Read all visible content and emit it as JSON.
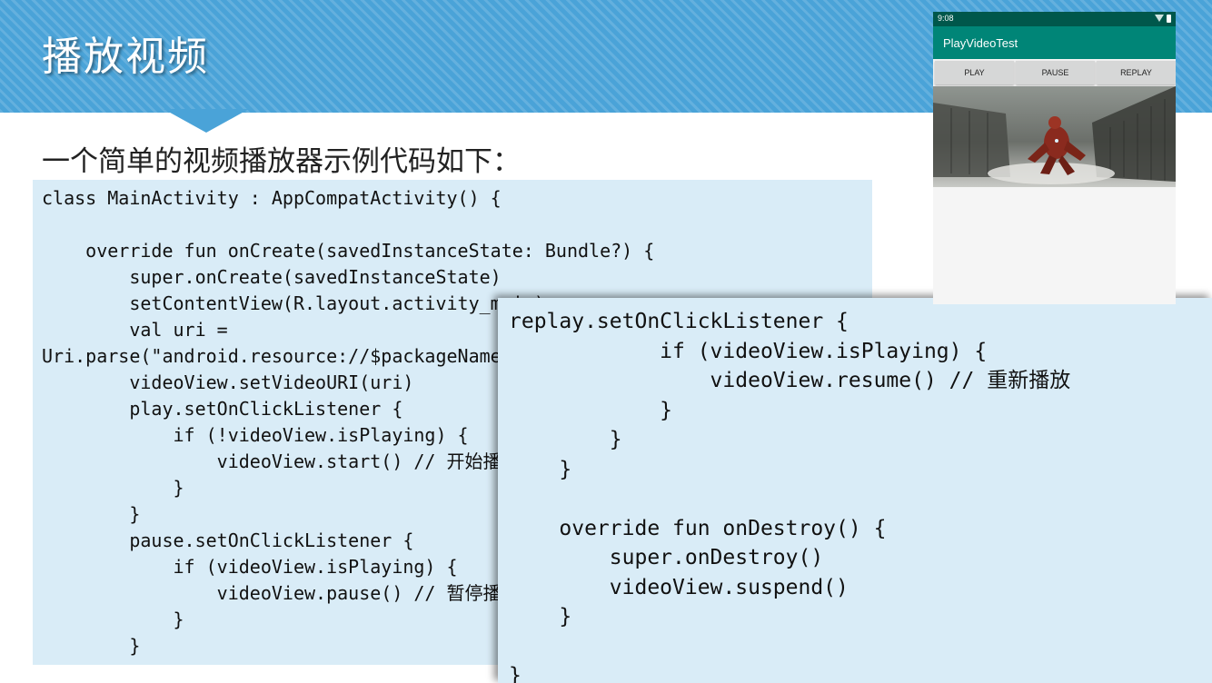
{
  "slide": {
    "title": "播放视频",
    "intro": "一个简单的视频播放器示例代码如下："
  },
  "code_main": "class MainActivity : AppCompatActivity() {\n\n    override fun onCreate(savedInstanceState: Bundle?) {\n        super.onCreate(savedInstanceState)\n        setContentView(R.layout.activity_main)\n        val uri =\nUri.parse(\"android.resource://$packageName/${R.raw.video}\")\n        videoView.setVideoURI(uri)\n        play.setOnClickListener {\n            if (!videoView.isPlaying) {\n                videoView.start() // 开始播放\n            }\n        }\n        pause.setOnClickListener {\n            if (videoView.isPlaying) {\n                videoView.pause() // 暂停播放\n            }\n        }",
  "code_overlay": "replay.setOnClickListener {\n            if (videoView.isPlaying) {\n                videoView.resume() // 重新播放\n            }\n        }\n    }\n\n    override fun onDestroy() {\n        super.onDestroy()\n        videoView.suspend()\n    }\n\n}",
  "phone": {
    "status_time": "9:08",
    "app_title": "PlayVideoTest",
    "buttons": [
      "PLAY",
      "PAUSE",
      "REPLAY"
    ],
    "colors": {
      "status_bar": "#00574b",
      "app_bar": "#008577",
      "button": "#d6d7d7"
    },
    "icons": [
      "wifi-icon",
      "battery-icon"
    ]
  },
  "colors": {
    "banner": "#4aa3d8",
    "code_bg": "#d9ecf7"
  }
}
